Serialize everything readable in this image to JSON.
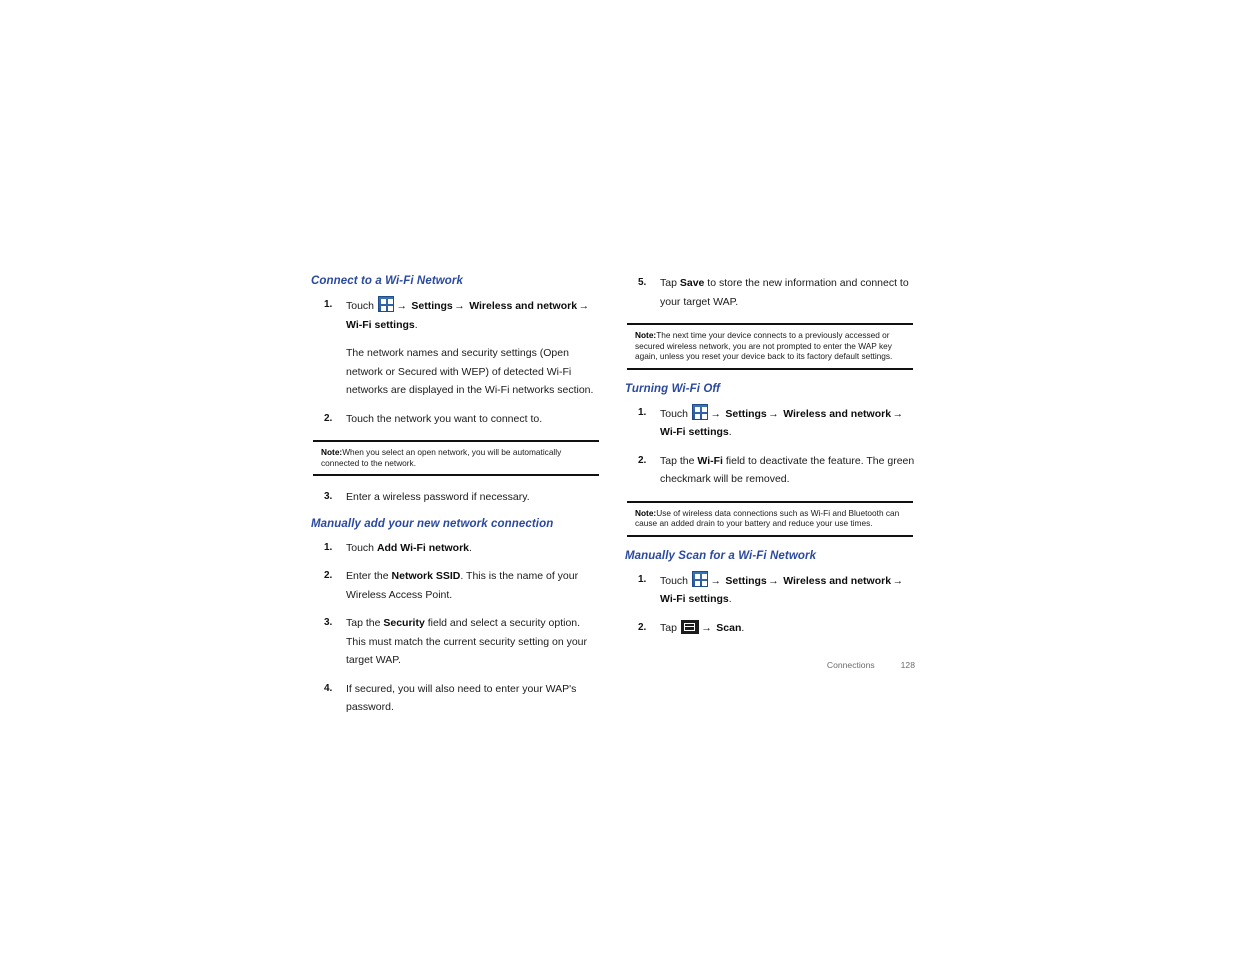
{
  "document": {
    "footer": {
      "section": "Connections",
      "page_number": "128"
    }
  },
  "icons": {
    "apps_icon": "apps-grid-icon",
    "menu_icon": "menu-key-icon"
  },
  "left_column": {
    "section1": {
      "heading": "Connect to a Wi-Fi Network",
      "steps": [
        {
          "num": "1.",
          "pre": "Touch ",
          "has_apps_icon": true,
          "path": [
            " Settings",
            " Wireless and network",
            " Wi-Fi settings"
          ],
          "post": "."
        },
        {
          "num": "2.",
          "text": "Touch the network you want to connect to."
        },
        {
          "num": "3.",
          "text": "Enter a wireless password if necessary."
        }
      ],
      "paragraph": "The network names and security settings (Open network or Secured with WEP) of detected Wi-Fi networks are displayed in the Wi-Fi networks section."
    },
    "note1": {
      "label": "Note:",
      "text": "When you select an open network, you will be automatically connected to the network."
    },
    "section2": {
      "heading": "Manually add your new network connection",
      "steps": [
        {
          "num": "1.",
          "plain_before": "Touch ",
          "bold": "Add Wi-Fi network",
          "plain_after": "."
        },
        {
          "num": "2.",
          "plain_before": " Enter the ",
          "bold": "Network SSID",
          "plain_after": ". This is the name of your Wireless Access Point."
        },
        {
          "num": "3.",
          "plain_before": "Tap the ",
          "bold": "Security",
          "plain_after": " field and select a security option. This must match the current security setting on your target WAP."
        },
        {
          "num": "4.",
          "plain_before": " If secured, you will also need to enter your WAP's password.",
          "bold": "",
          "plain_after": ""
        }
      ]
    }
  },
  "right_column": {
    "step5": {
      "num": "5.",
      "plain_before": "Tap ",
      "bold": "Save",
      "plain_after": " to store the new information and connect to your target WAP."
    },
    "note2": {
      "label": "Note:",
      "text": "The next time your device connects to a previously accessed or secured wireless network, you are not prompted to enter the WAP key again, unless you reset your device back to its factory default settings."
    },
    "section3": {
      "heading": "Turning Wi-Fi Off",
      "step1": {
        "num": "1.",
        "pre": "Touch ",
        "path": [
          " Settings",
          " Wireless and network",
          " Wi-Fi settings"
        ],
        "post": "."
      },
      "step2": {
        "num": "2.",
        "plain_before": "Tap the ",
        "bold": "Wi-Fi",
        "plain_after": " field to deactivate the feature. The green checkmark will be removed."
      }
    },
    "note3": {
      "label": "Note:",
      "text": "Use of wireless data connections such as Wi-Fi and Bluetooth can cause an added drain to your battery and reduce your use times."
    },
    "section4": {
      "heading": "Manually Scan for a Wi-Fi Network",
      "step1": {
        "num": "1.",
        "pre": "Touch ",
        "path": [
          " Settings",
          " Wireless and network",
          " Wi-Fi settings"
        ],
        "post": "."
      },
      "step2": {
        "num": "2.",
        "pre": "Tap ",
        "target": " Scan",
        "post": "."
      }
    }
  },
  "symbols": {
    "arrow": "→"
  }
}
